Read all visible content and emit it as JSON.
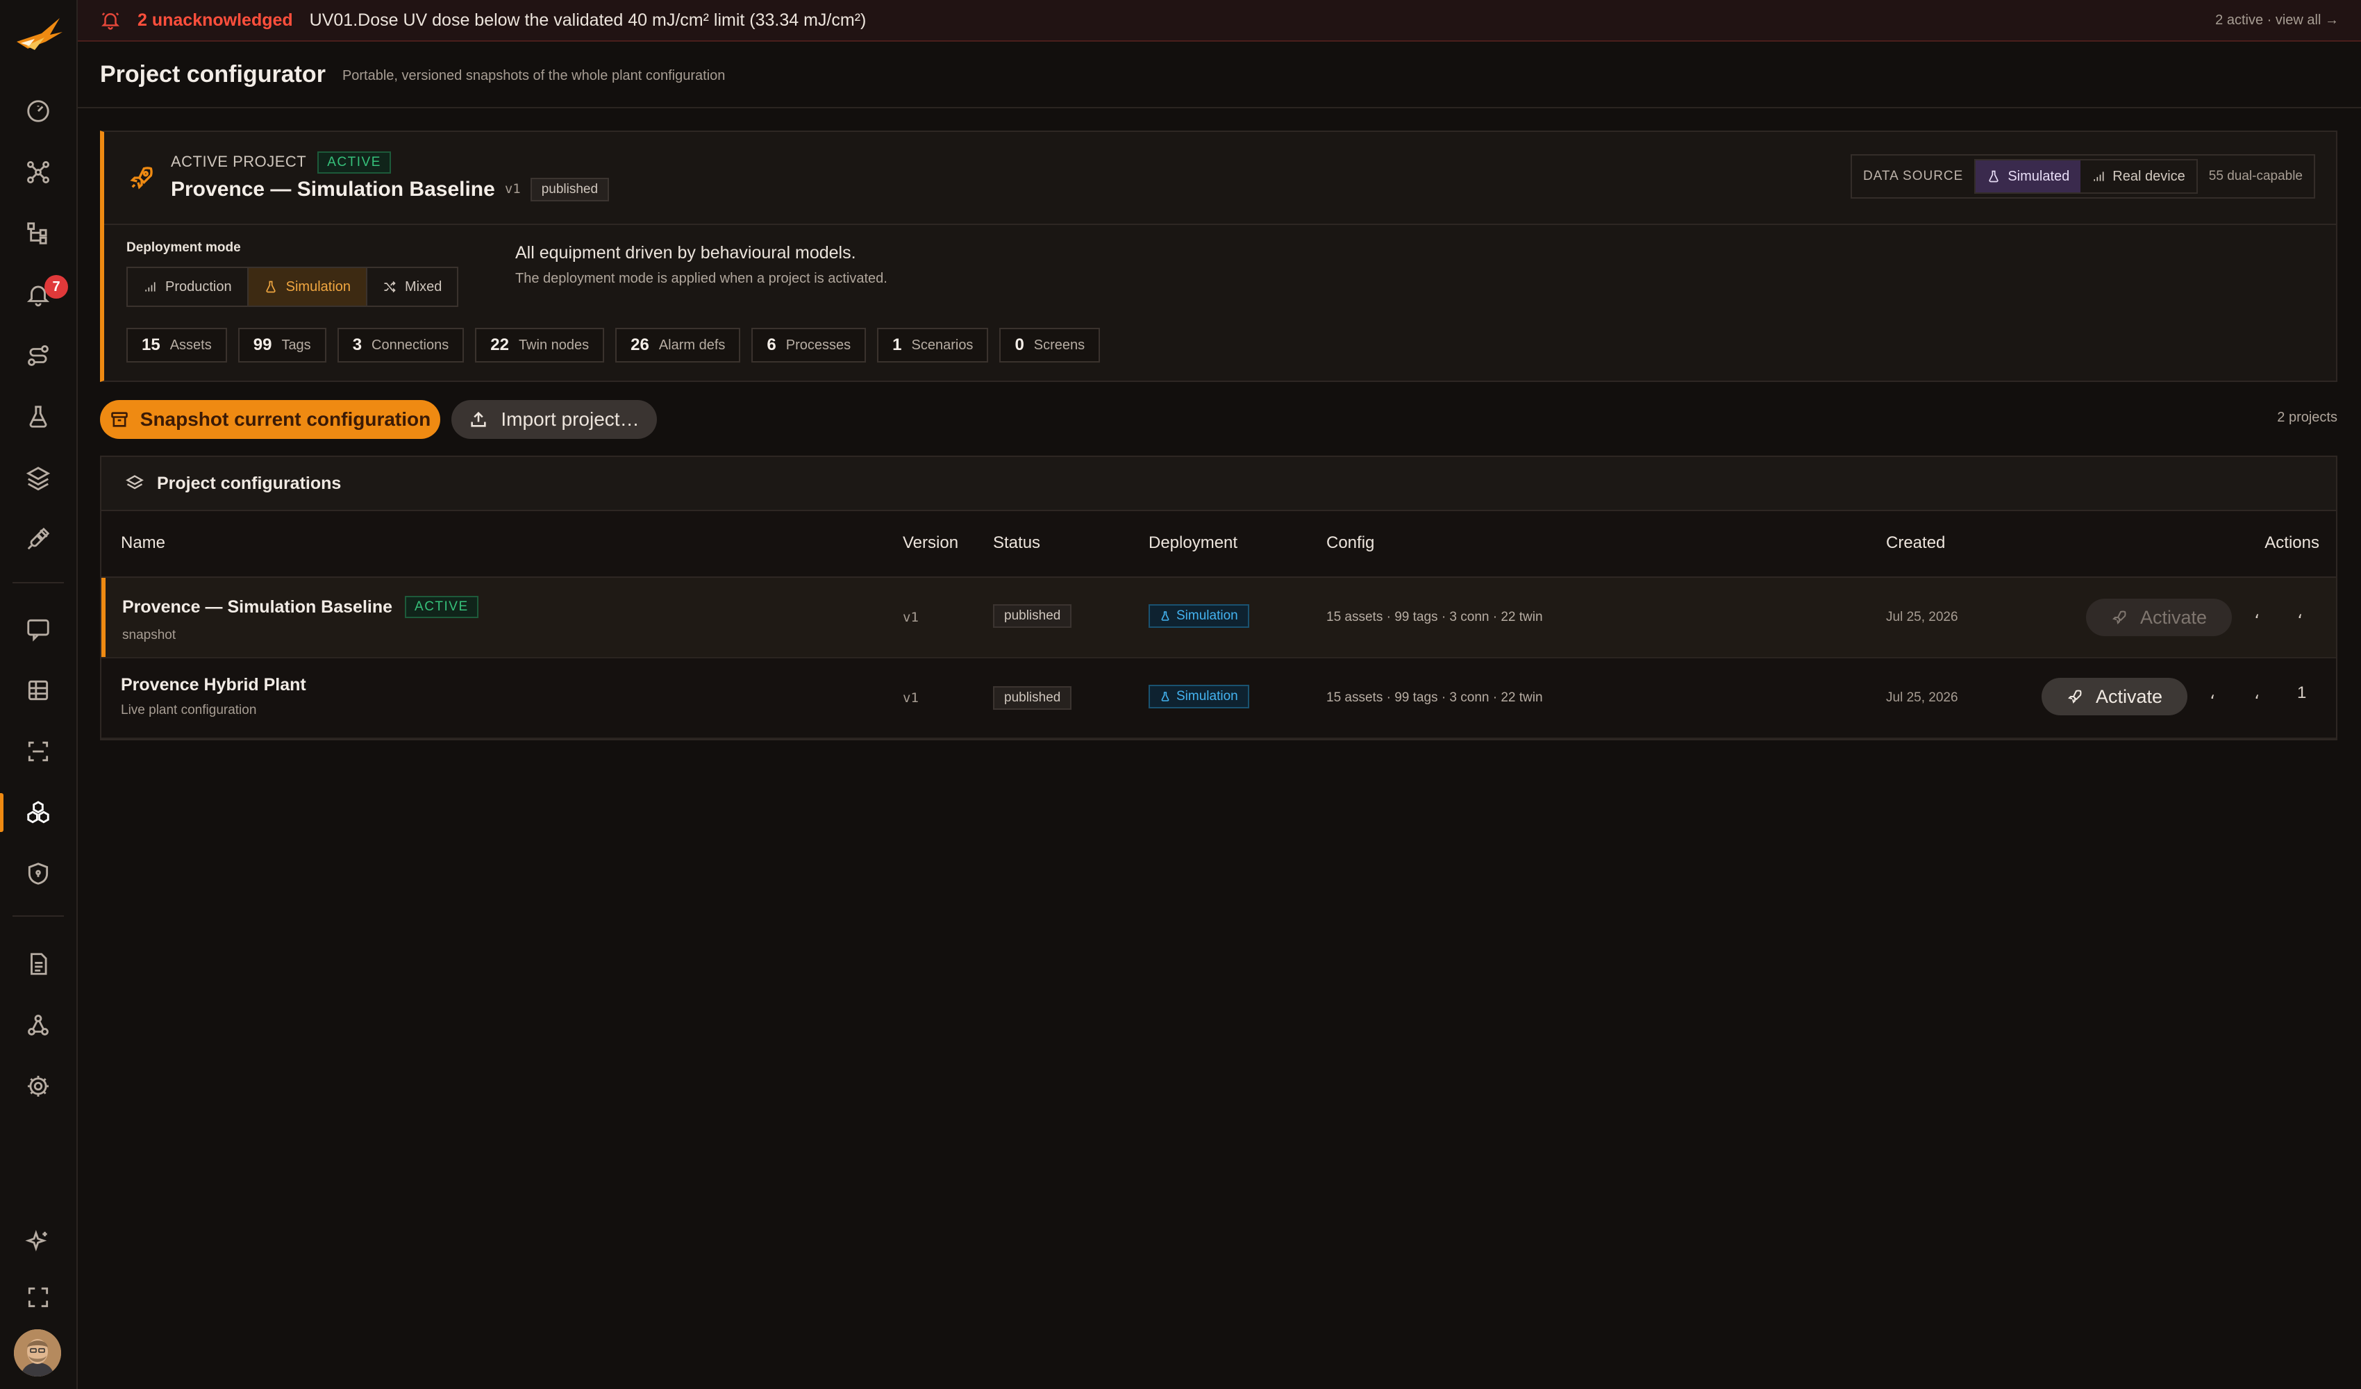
{
  "alarm": {
    "count_label": "2 unacknowledged",
    "message": "UV01.Dose UV dose below the validated 40 mJ/cm² limit (33.34 mJ/cm²)",
    "right_link": "2 active · view all →"
  },
  "sidebar": {
    "alarm_badge": "7",
    "items": [
      "gauge",
      "topology",
      "hierarchy",
      "alarms",
      "routes",
      "lab",
      "layers",
      "plug",
      "chat",
      "grid",
      "scan",
      "project-config",
      "shield",
      "document",
      "network",
      "settings",
      "sparkle",
      "fullscreen"
    ],
    "active_item": "project-config"
  },
  "header": {
    "title": "Project configurator",
    "subtitle": "Portable, versioned snapshots of the whole plant configuration"
  },
  "active_project": {
    "kicker": "ACTIVE PROJECT",
    "status": "ACTIVE",
    "name": "Provence — Simulation Baseline",
    "version": "v1",
    "state": "published",
    "data_source": {
      "label": "DATA SOURCE",
      "options": [
        "Simulated",
        "Real device"
      ],
      "selected": "Simulated",
      "extra": "55 dual-capable"
    },
    "deployment": {
      "label": "Deployment mode",
      "options": [
        "Production",
        "Simulation",
        "Mixed"
      ],
      "selected": "Simulation",
      "description": "All equipment driven by behavioural models.",
      "note": "The deployment mode is applied when a project is activated."
    },
    "stats": [
      {
        "n": "15",
        "label": "Assets"
      },
      {
        "n": "99",
        "label": "Tags"
      },
      {
        "n": "3",
        "label": "Connections"
      },
      {
        "n": "22",
        "label": "Twin nodes"
      },
      {
        "n": "26",
        "label": "Alarm defs"
      },
      {
        "n": "6",
        "label": "Processes"
      },
      {
        "n": "1",
        "label": "Scenarios"
      },
      {
        "n": "0",
        "label": "Screens"
      }
    ]
  },
  "actions": {
    "snapshot": "Snapshot current configuration",
    "import": "Import project…",
    "count": "2 projects"
  },
  "table": {
    "title": "Project configurations",
    "columns": [
      "Name",
      "Version",
      "Status",
      "Deployment",
      "Config",
      "Created",
      "Actions"
    ],
    "rows": [
      {
        "name": "Provence — Simulation Baseline",
        "badge": "ACTIVE",
        "sub": "snapshot",
        "version": "v1",
        "status": "published",
        "deployment": "Simulation",
        "config": "15 assets · 99 tags · 3 conn · 22 twin",
        "created": "Jul 25, 2026",
        "action": "Activate",
        "action_enabled": false,
        "glyphs": [
          "،",
          "،"
        ]
      },
      {
        "name": "Provence Hybrid Plant",
        "badge": "",
        "sub": "Live plant configuration",
        "version": "v1",
        "status": "published",
        "deployment": "Simulation",
        "config": "15 assets · 99 tags · 3 conn · 22 twin",
        "created": "Jul 25, 2026",
        "action": "Activate",
        "action_enabled": true,
        "glyphs": [
          "،",
          "،",
          "1"
        ]
      }
    ]
  },
  "colors": {
    "accent": "#ef8a12",
    "alarm": "#ff4f3c",
    "active_green": "#36c07a",
    "sim_blue": "#44b3f0"
  }
}
